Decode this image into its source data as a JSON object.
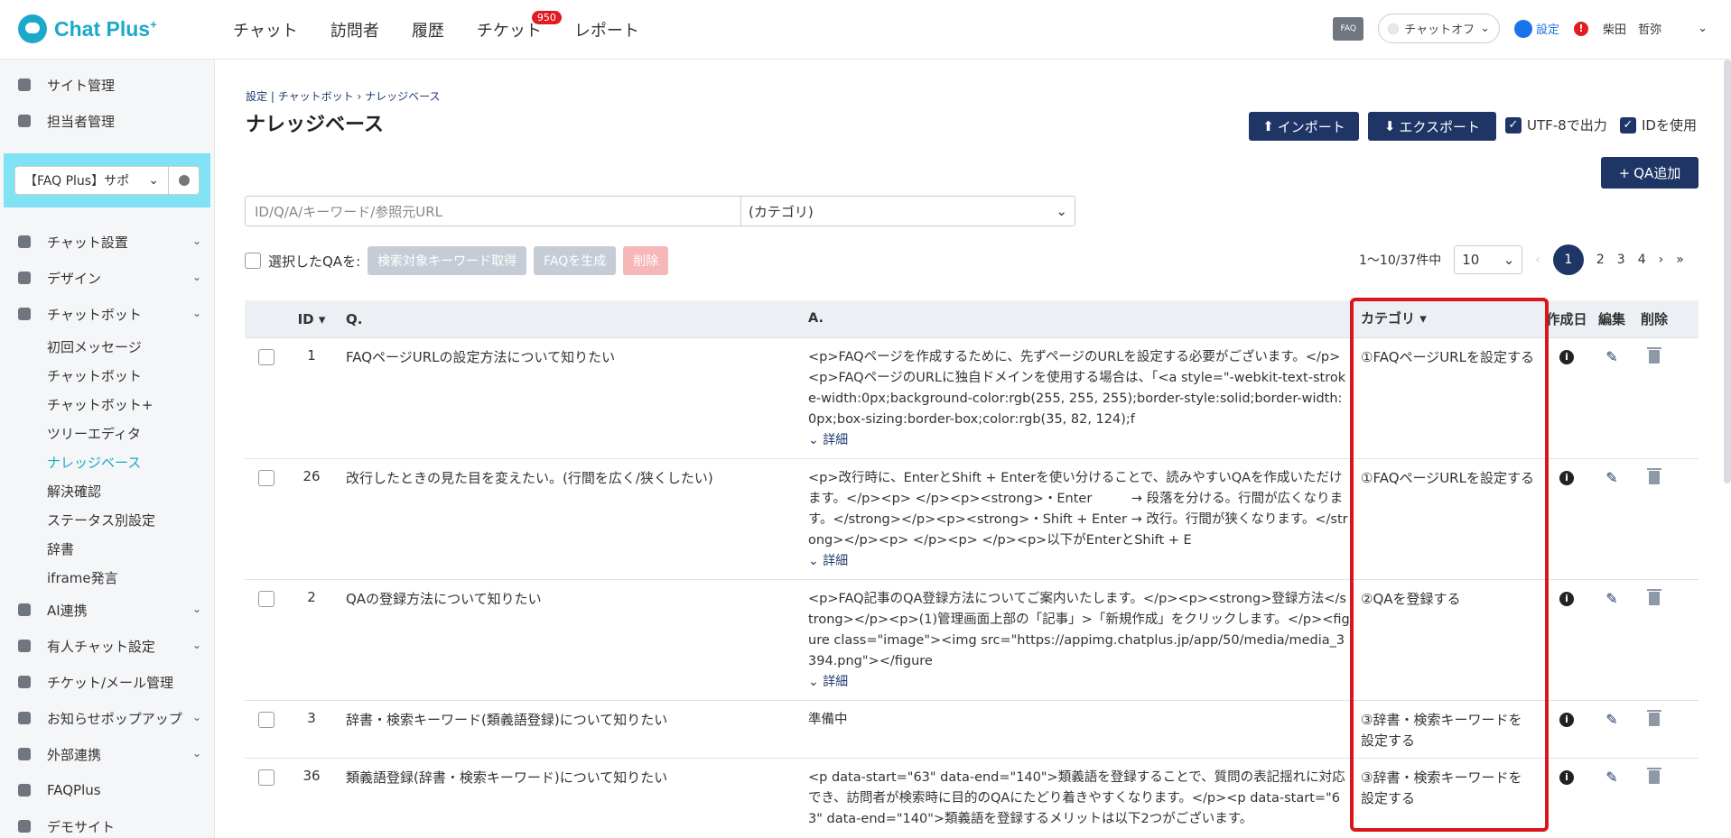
{
  "app": {
    "logo": "Chat Plus",
    "logo_sup": "+"
  },
  "topnav": {
    "items": [
      "チャット",
      "訪問者",
      "履歴",
      "チケット",
      "レポート"
    ],
    "ticket_badge": "950"
  },
  "topright": {
    "faq_label": "FAQ",
    "chat_status": "チャットオフ",
    "settings_label": "設定",
    "alert": "!",
    "user_last": "柴田",
    "user_first": "哲弥"
  },
  "sidebar": {
    "site_admin": "サイト管理",
    "staff_admin": "担当者管理",
    "site_select": "【FAQ Plus】サポ",
    "chat_setup": "チャット設置",
    "design": "デザイン",
    "chatbot": "チャットボット",
    "chatbot_children": [
      "初回メッセージ",
      "チャットボット",
      "チャットボット+",
      "ツリーエディタ",
      "ナレッジベース",
      "解決確認",
      "ステータス別設定",
      "辞書",
      "iframe発言"
    ],
    "ai": "AI連携",
    "manned": "有人チャット設定",
    "ticket": "チケット/メール管理",
    "popup": "お知らせポップアップ",
    "external": "外部連携",
    "faqplus": "FAQPlus",
    "demo": "デモサイト"
  },
  "main": {
    "breadcrumb": [
      "設定",
      "チャットボット",
      "ナレッジベース"
    ],
    "breadcrumb_sep1": "|",
    "breadcrumb_sep2": "›",
    "title": "ナレッジベース",
    "import_label": "インポート",
    "export_label": "エクスポート",
    "utf8_label": "UTF-8で出力",
    "use_id_label": "IDを使用",
    "qa_add_label": "QA追加",
    "search_placeholder": "ID/Q/A/キーワード/参照元URL",
    "category_placeholder": "(カテゴリ)",
    "bulk_label": "選択したQAを:",
    "bulk_keyword": "検索対象キーワード取得",
    "bulk_faq": "FAQを生成",
    "bulk_delete": "削除",
    "count_text": "1〜10/37件中",
    "per_page": "10",
    "pages": [
      "1",
      "2",
      "3",
      "4"
    ],
    "next": "›",
    "last": "»",
    "prev": "‹"
  },
  "table": {
    "headers": {
      "id": "ID",
      "q": "Q.",
      "a": "A.",
      "category": "カテゴリ",
      "created": "作成日",
      "edit": "編集",
      "delete": "削除"
    },
    "detail_label": "詳細",
    "rows": [
      {
        "id": "1",
        "q": "FAQページURLの設定方法について知りたい",
        "a": "<p>FAQページを作成するために、先ずページのURLを設定する必要がございます。</p><p>FAQページのURLに独自ドメインを使用する場合は、「<a style=\"-webkit-text-stroke-width:0px;background-color:rgb(255, 255, 255);border-style:solid;border-width:0px;box-sizing:border-box;color:rgb(35, 82, 124);f",
        "category": "①FAQページURLを設定する",
        "detail": true
      },
      {
        "id": "26",
        "q": "改行したときの見た目を変えたい。(行間を広く/狭くしたい)",
        "a": "<p>改行時に、EnterとShift + Enterを使い分けることで、読みやすいQAを作成いただけます。</p><p> </p><p><strong>・Enter　　　→ 段落を分ける。行間が広くなります。</strong></p><p><strong>・Shift + Enter → 改行。行間が狭くなります。</strong></p><p> </p><p> </p><p>以下がEnterとShift + E",
        "category": "①FAQページURLを設定する",
        "detail": true
      },
      {
        "id": "2",
        "q": "QAの登録方法について知りたい",
        "a": "<p>FAQ記事のQA登録方法についてご案内いたします。</p><p><strong>登録方法</strong></p><p>(1)管理画面上部の「記事」>「新規作成」をクリックします。</p><figure class=\"image\"><img src=\"https://appimg.chatplus.jp/app/50/media/media_3394.png\"></figure",
        "category": "②QAを登録する",
        "detail": true
      },
      {
        "id": "3",
        "q": "辞書・検索キーワード(類義語登録)について知りたい",
        "a": "準備中",
        "category": "③辞書・検索キーワードを設定する",
        "detail": false
      },
      {
        "id": "36",
        "q": "類義語登録(辞書・検索キーワード)について知りたい",
        "a": "<p data-start=\"63\" data-end=\"140\">類義語を登録することで、質問の表記揺れに対応でき、訪問者が検索時に目的のQAにたどり着きやすくなります。</p><p data-start=\"63\" data-end=\"140\">類義語を登録するメリットは以下2つがございます。",
        "category": "③辞書・検索キーワードを設定する",
        "detail": false
      }
    ]
  }
}
